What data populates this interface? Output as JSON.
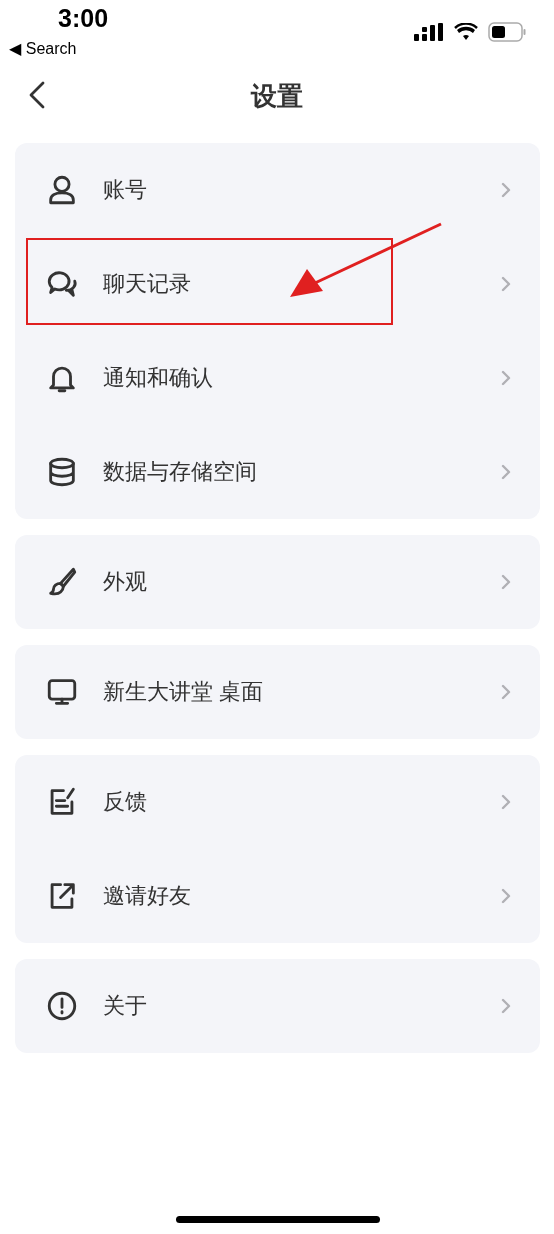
{
  "status_bar": {
    "time": "3:00",
    "back_app": "◀ Search"
  },
  "nav": {
    "title": "设置"
  },
  "groups": [
    {
      "items": [
        {
          "label": "账号",
          "kind": "person",
          "highlighted": false
        },
        {
          "label": "聊天记录",
          "kind": "chat",
          "highlighted": true
        },
        {
          "label": "通知和确认",
          "kind": "bell",
          "highlighted": false
        },
        {
          "label": "数据与存储空间",
          "kind": "database",
          "highlighted": false
        }
      ]
    },
    {
      "items": [
        {
          "label": "外观",
          "kind": "brush",
          "highlighted": false
        }
      ]
    },
    {
      "items": [
        {
          "label": "新生大讲堂 桌面",
          "kind": "monitor",
          "highlighted": false
        }
      ]
    },
    {
      "items": [
        {
          "label": "反馈",
          "kind": "edit",
          "highlighted": false
        },
        {
          "label": "邀请好友",
          "kind": "share",
          "highlighted": false
        }
      ]
    },
    {
      "items": [
        {
          "label": "关于",
          "kind": "info",
          "highlighted": false
        }
      ]
    }
  ]
}
